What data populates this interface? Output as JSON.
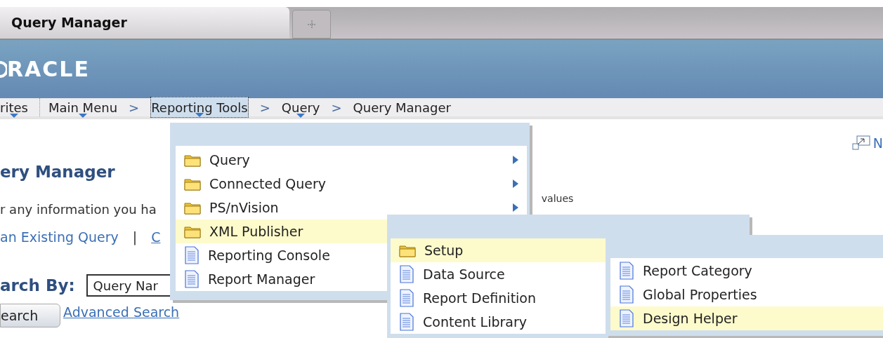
{
  "tabs": [
    {
      "label": "Query Manager",
      "selected": true
    }
  ],
  "banner": {
    "logo": "RACLE"
  },
  "breadcrumbs": [
    {
      "label": "rites",
      "dropdown": true,
      "selected": false
    },
    {
      "label": "Main Menu",
      "dropdown": true,
      "selected": false
    },
    {
      "label": "Reporting Tools",
      "dropdown": true,
      "selected": true
    },
    {
      "label": "Query",
      "dropdown": true,
      "selected": false
    },
    {
      "label": "Query Manager",
      "dropdown": false,
      "selected": false
    }
  ],
  "separator": ">",
  "page": {
    "new_window_link": "N",
    "heading": "ery Manager",
    "instructions": "r any information you ha",
    "instructions_tail": "values",
    "links": [
      "an Existing Query",
      "C"
    ],
    "link_divider": "|",
    "search_by_label": "arch By:",
    "search_by_value": "Query Nar",
    "search_button": "earch",
    "advanced_search": "Advanced Search"
  },
  "menus": [
    {
      "items": [
        {
          "label": "Query",
          "kind": "folder",
          "submenu": true,
          "selected": false
        },
        {
          "label": "Connected Query",
          "kind": "folder",
          "submenu": true,
          "selected": false
        },
        {
          "label": "PS/nVision",
          "kind": "folder",
          "submenu": true,
          "selected": false
        },
        {
          "label": "XML Publisher",
          "kind": "folder",
          "selected": true
        },
        {
          "label": "Reporting Console",
          "kind": "document",
          "selected": false
        },
        {
          "label": "Report Manager",
          "kind": "document",
          "selected": false
        }
      ]
    },
    {
      "items": [
        {
          "label": "Setup",
          "kind": "folder",
          "selected": true
        },
        {
          "label": "Data Source",
          "kind": "document",
          "selected": false
        },
        {
          "label": "Report Definition",
          "kind": "document",
          "selected": false
        },
        {
          "label": "Content Library",
          "kind": "document",
          "selected": false
        }
      ]
    },
    {
      "items": [
        {
          "label": "Report Category",
          "kind": "document",
          "selected": false
        },
        {
          "label": "Global Properties",
          "kind": "document",
          "selected": false
        },
        {
          "label": "Design Helper",
          "kind": "document",
          "selected": true
        }
      ]
    }
  ]
}
